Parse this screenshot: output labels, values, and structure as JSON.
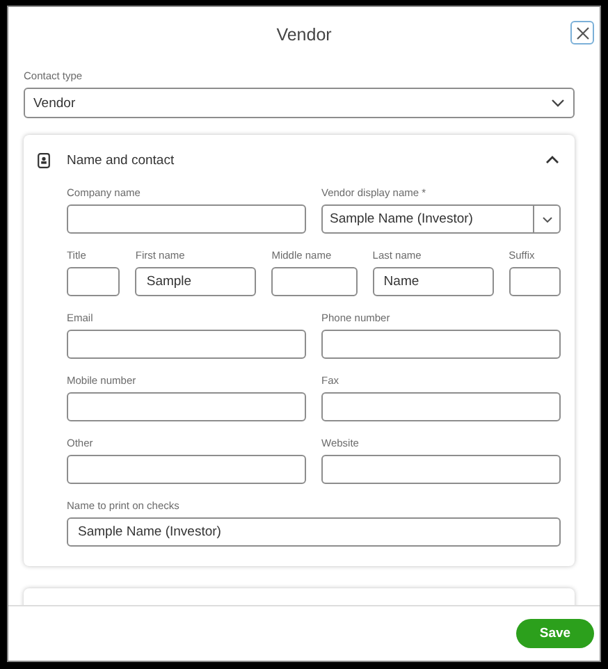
{
  "dialog": {
    "title": "Vendor"
  },
  "contact_type": {
    "label": "Contact type",
    "value": "Vendor"
  },
  "section": {
    "title": "Name and contact",
    "expanded": true,
    "rows": [
      [
        {
          "label": "Company name",
          "kind": "text"
        },
        {
          "label": "Vendor display name *",
          "kind": "dropdown",
          "value": "Sample Name (Investor)"
        }
      ],
      [
        {
          "label": "Title",
          "kind": "text"
        },
        {
          "label": "First name",
          "kind": "text",
          "value": "Sample"
        },
        {
          "label": "Middle name",
          "kind": "text"
        },
        {
          "label": "Last name",
          "kind": "text",
          "value": "Name"
        },
        {
          "label": "Suffix",
          "kind": "text"
        }
      ],
      [
        {
          "label": "Email",
          "kind": "text"
        },
        {
          "label": "Phone number",
          "kind": "text"
        }
      ],
      [
        {
          "label": "Mobile number",
          "kind": "text"
        },
        {
          "label": "Fax",
          "kind": "text"
        }
      ],
      [
        {
          "label": "Other",
          "kind": "text"
        },
        {
          "label": "Website",
          "kind": "text"
        }
      ],
      [
        {
          "label": "Name to print on checks",
          "kind": "text",
          "value": "Sample Name (Investor)"
        }
      ]
    ]
  },
  "footer": {
    "save": "Save"
  }
}
